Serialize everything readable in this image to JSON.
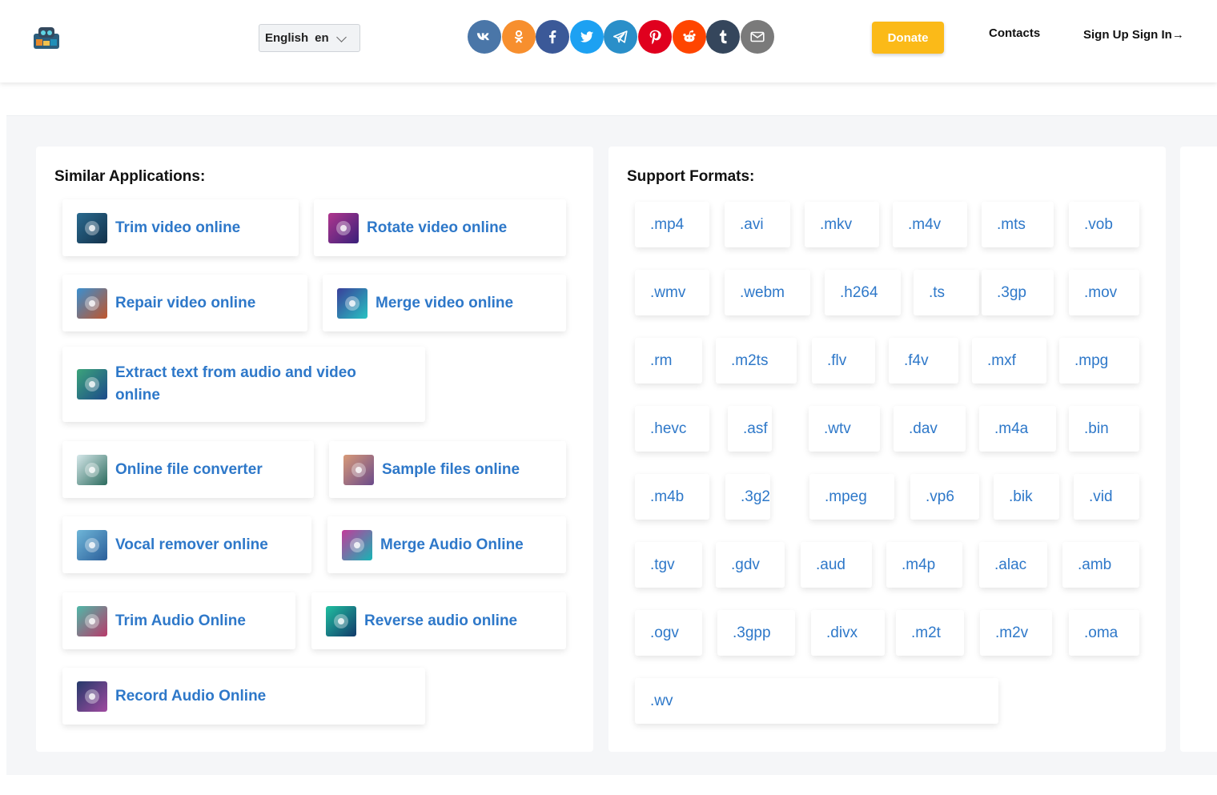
{
  "header": {
    "language_label": "English",
    "language_code": "en",
    "donate_label": "Donate",
    "contacts_label": "Contacts",
    "auth_label": "Sign Up Sign In→",
    "socials": [
      {
        "name": "vk-icon",
        "color": "#4a76a8",
        "glyph": "vk"
      },
      {
        "name": "odnoklassniki-icon",
        "color": "#f78f2e",
        "glyph": "ok"
      },
      {
        "name": "facebook-icon",
        "color": "#3b5998",
        "glyph": "f"
      },
      {
        "name": "twitter-icon",
        "color": "#1da1f2",
        "glyph": "tw"
      },
      {
        "name": "telegram-icon",
        "color": "#2a8fc9",
        "glyph": "tg"
      },
      {
        "name": "pinterest-icon",
        "color": "#e0001e",
        "glyph": "p"
      },
      {
        "name": "reddit-icon",
        "color": "#ff4500",
        "glyph": "rd"
      },
      {
        "name": "tumblr-icon",
        "color": "#35465c",
        "glyph": "t"
      },
      {
        "name": "email-icon",
        "color": "#7a7a7a",
        "glyph": "mail"
      }
    ]
  },
  "similar": {
    "title": "Similar Applications:",
    "items": [
      {
        "label": "Trim video online",
        "icon": "trim-video-icon",
        "colors": [
          "#2a6a8f",
          "#13314a"
        ]
      },
      {
        "label": "Rotate video online",
        "icon": "rotate-video-icon",
        "colors": [
          "#b0368e",
          "#39207a"
        ]
      },
      {
        "label": "Repair video online",
        "icon": "repair-video-icon",
        "colors": [
          "#3a8fd0",
          "#c0552b"
        ]
      },
      {
        "label": "Merge video online",
        "icon": "merge-video-icon",
        "colors": [
          "#3a3f9a",
          "#27c2c2"
        ]
      },
      {
        "label": "Extract text from audio and video online",
        "icon": "extract-text-icon",
        "colors": [
          "#3ca47a",
          "#1c4a8a"
        ]
      },
      {
        "label": "Online file converter",
        "icon": "file-converter-icon",
        "colors": [
          "#d6e8ea",
          "#2c6b5e"
        ]
      },
      {
        "label": "Sample files online",
        "icon": "sample-files-icon",
        "colors": [
          "#d89a78",
          "#6a4a8a"
        ]
      },
      {
        "label": "Vocal remover online",
        "icon": "vocal-remover-icon",
        "colors": [
          "#6fb6d8",
          "#2a5e9a"
        ]
      },
      {
        "label": "Merge Audio Online",
        "icon": "merge-audio-icon",
        "colors": [
          "#c33a9a",
          "#16b5b5"
        ]
      },
      {
        "label": "Trim Audio Online",
        "icon": "trim-audio-icon",
        "colors": [
          "#4fb8a8",
          "#b83a6a"
        ]
      },
      {
        "label": "Reverse audio online",
        "icon": "reverse-audio-icon",
        "colors": [
          "#20c0a0",
          "#123a6a"
        ]
      },
      {
        "label": "Record Audio Online",
        "icon": "record-audio-icon",
        "colors": [
          "#253a6a",
          "#a04aa0"
        ]
      }
    ]
  },
  "formats": {
    "title": "Support Formats:",
    "items": [
      ".mp4",
      ".avi",
      ".mkv",
      ".m4v",
      ".mts",
      ".vob",
      ".wmv",
      ".webm",
      ".h264",
      ".ts",
      ".3gp",
      ".mov",
      ".rm",
      ".m2ts",
      ".flv",
      ".f4v",
      ".mxf",
      ".mpg",
      ".hevc",
      ".asf",
      ".wtv",
      ".dav",
      ".m4a",
      ".bin",
      ".m4b",
      ".3g2",
      ".mpeg",
      ".vp6",
      ".bik",
      ".vid",
      ".tgv",
      ".gdv",
      ".aud",
      ".m4p",
      ".alac",
      ".amb",
      ".ogv",
      ".3gpp",
      ".divx",
      ".m2t",
      ".m2v",
      ".oma",
      ".wv"
    ]
  }
}
